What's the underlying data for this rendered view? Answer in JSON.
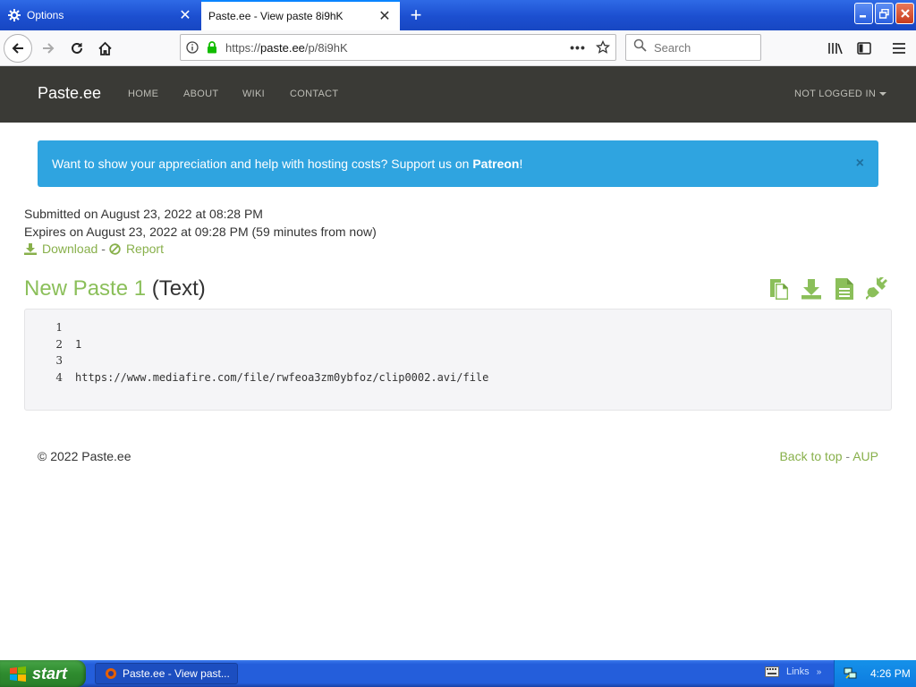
{
  "browser": {
    "tabs": [
      {
        "title": "Options"
      },
      {
        "title": "Paste.ee - View paste 8i9hK"
      }
    ],
    "url": {
      "scheme": "https://",
      "host": "paste.ee",
      "path": "/p/8i9hK"
    },
    "search": {
      "placeholder": "Search"
    }
  },
  "site": {
    "brand": "Paste.ee",
    "nav": [
      "HOME",
      "ABOUT",
      "WIKI",
      "CONTACT"
    ],
    "login_label": "NOT LOGGED IN"
  },
  "alert": {
    "text": "Want to show your appreciation and help with hosting costs? Support us on ",
    "link": "Patreon",
    "suffix": "!",
    "close": "×"
  },
  "paste": {
    "submitted": "Submitted on August 23, 2022 at 08:28 PM",
    "expires": "Expires on August 23, 2022 at 09:28 PM (59 minutes from now)",
    "download_label": "Download",
    "separator": "-",
    "report_label": "Report",
    "title": "New Paste 1",
    "type": "(Text)",
    "line_numbers": [
      "1",
      "2",
      "3",
      "4"
    ],
    "lines": [
      "",
      "1",
      "",
      "https://www.mediafire.com/file/rwfeoa3zm0ybfoz/clip0002.avi/file"
    ]
  },
  "footer": {
    "copyright": "© 2022 Paste.ee",
    "back_to_top": "Back to top",
    "separator": "-",
    "aup": "AUP"
  },
  "taskbar": {
    "start_label": "start",
    "task_title": "Paste.ee - View past...",
    "links_label": "Links",
    "clock": "4:26 PM"
  },
  "colors": {
    "accent_green": "#8bbf5a",
    "alert_blue": "#2fa4e0",
    "nav_bg": "#3a3a36"
  }
}
